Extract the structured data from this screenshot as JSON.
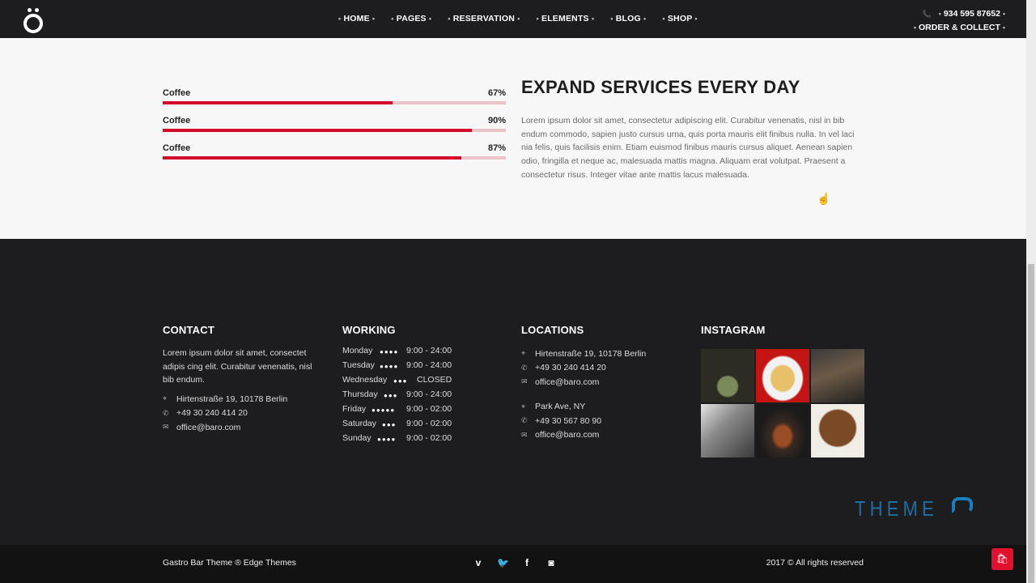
{
  "header": {
    "nav": [
      "HOME",
      "PAGES",
      "RESERVATION",
      "ELEMENTS",
      "BLOG",
      "SHOP"
    ],
    "phone": "934 595 87652",
    "order": "ORDER & COLLECT"
  },
  "skills": [
    {
      "label": "Coffee",
      "pct_text": "67%",
      "value": 67
    },
    {
      "label": "Coffee",
      "pct_text": "90%",
      "value": 90
    },
    {
      "label": "Coffee",
      "pct_text": "87%",
      "value": 87
    }
  ],
  "expand": {
    "title": "EXPAND SERVICES EVERY DAY",
    "text": "Lorem ipsum dolor sit amet, consectetur adipiscing elit. Curabitur venenatis, nisl in bib endum commodo, sapien justo cursus urna, quis porta mauris elit finibus nulla. In vel laci nia felis, quis facilisis enim. Etiam euismod finibus mauris cursus aliquet. Aenean sapien odio, fringilla et neque ac, malesuada mattis magna. Aliquam erat volutpat. Praesent a consectetur risus. Integer vitae ante mattis lacus malesuada."
  },
  "footer": {
    "contact": {
      "title": "CONTACT",
      "text": "Lorem ipsum dolor sit amet, consectet adipis cing elit. Curabitur venenatis, nisl bib endum.",
      "address": "Hirtenstraße 19, 10178 Berlin",
      "phone": "+49 30 240 414 20",
      "email": "office@baro.com"
    },
    "working": {
      "title": "WORKING",
      "hours": [
        {
          "day": "Monday",
          "time": "9:00 - 24:00"
        },
        {
          "day": "Tuesday",
          "time": "9:00 - 24:00"
        },
        {
          "day": "Wednesday",
          "time": "CLOSED"
        },
        {
          "day": "Thursday",
          "time": "9:00 - 24:00"
        },
        {
          "day": "Friday",
          "time": "9:00 - 02:00"
        },
        {
          "day": "Saturday",
          "time": "9:00 - 02:00"
        },
        {
          "day": "Sunday",
          "time": "9:00 - 02:00"
        }
      ]
    },
    "locations": {
      "title": "LOCATIONS",
      "items": [
        {
          "address": "Hirtenstraße 19, 10178 Berlin",
          "phone": "+49 30 240 414 20",
          "email": "office@baro.com"
        },
        {
          "address": "Park Ave, NY",
          "phone": "+49 30 567 80 90",
          "email": "office@baro.com"
        }
      ]
    },
    "instagram": {
      "title": "INSTAGRAM"
    },
    "watermark": "THEME"
  },
  "bottom": {
    "left": "Gastro Bar Theme ® Edge Themes",
    "right": "2017 © All rights reserved",
    "social": [
      "vimeo-icon",
      "twitter-icon",
      "facebook-icon",
      "instagram-icon"
    ]
  },
  "colors": {
    "accent": "#d40c2c",
    "track": "#ecc3c8",
    "dark": "#1d1d1f",
    "light_bg": "#f7f7f7"
  }
}
